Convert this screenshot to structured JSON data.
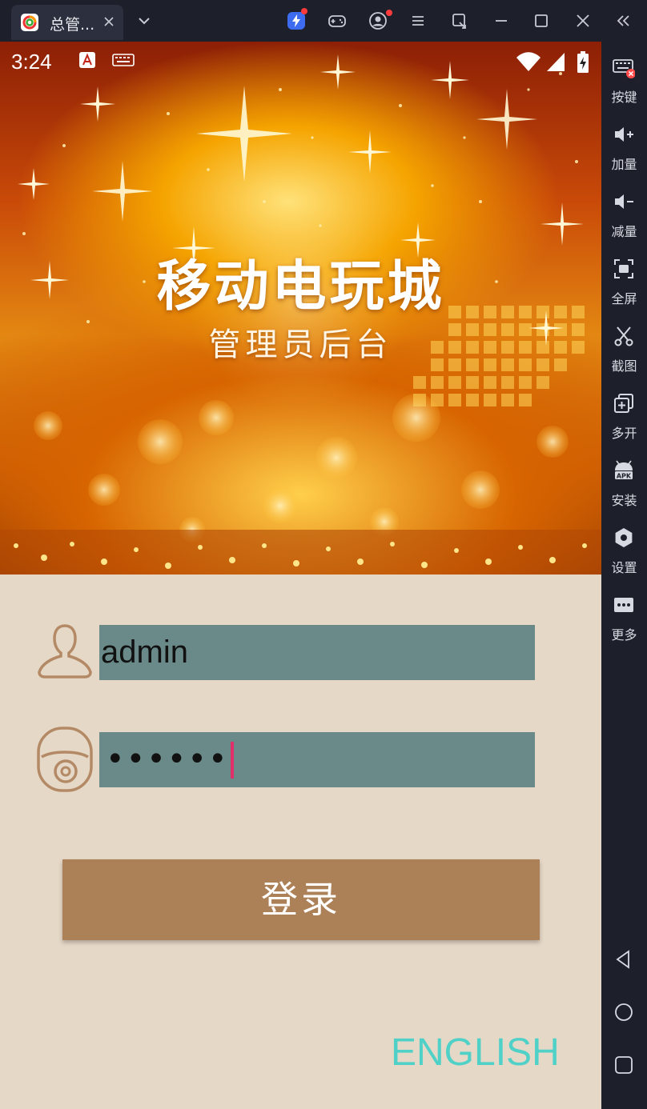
{
  "window": {
    "tab_title": "总管...",
    "tab_icon": "app-logo-icon",
    "toolbar_icons": [
      "lightning-icon",
      "gamepad-icon",
      "user-circle-icon",
      "menu-icon",
      "screen-rotate-icon",
      "minimize-icon",
      "maximize-icon",
      "close-icon",
      "collapse-icon"
    ]
  },
  "statusbar": {
    "time": "3:24",
    "left_icons": [
      "a-notification-icon",
      "keyboard-icon"
    ],
    "right_icons": [
      "wifi-icon",
      "signal-icon",
      "battery-charging-icon"
    ]
  },
  "banner": {
    "title": "移动电玩城",
    "subtitle": "管理员后台"
  },
  "login": {
    "username_value": "admin",
    "password_masked": "••••••",
    "login_button": "登录",
    "language_link": "ENGLISH"
  },
  "sidebar": {
    "items": [
      {
        "label": "按键",
        "icon": "keyboard-icon"
      },
      {
        "label": "加量",
        "icon": "volume-up-icon"
      },
      {
        "label": "减量",
        "icon": "volume-down-icon"
      },
      {
        "label": "全屏",
        "icon": "fullscreen-icon"
      },
      {
        "label": "截图",
        "icon": "scissors-icon"
      },
      {
        "label": "多开",
        "icon": "multi-instance-icon"
      },
      {
        "label": "安装",
        "icon": "apk-icon"
      },
      {
        "label": "设置",
        "icon": "settings-icon"
      },
      {
        "label": "更多",
        "icon": "more-icon"
      }
    ],
    "nav": [
      "back-icon",
      "home-icon",
      "recents-icon"
    ]
  },
  "colors": {
    "form_background": "#e5d8c7",
    "input_background": "#6a8a89",
    "button_background": "#ad8157",
    "english_link": "#4fd1c8",
    "icon_brown": "#b48a66",
    "caret": "#e0306a"
  }
}
